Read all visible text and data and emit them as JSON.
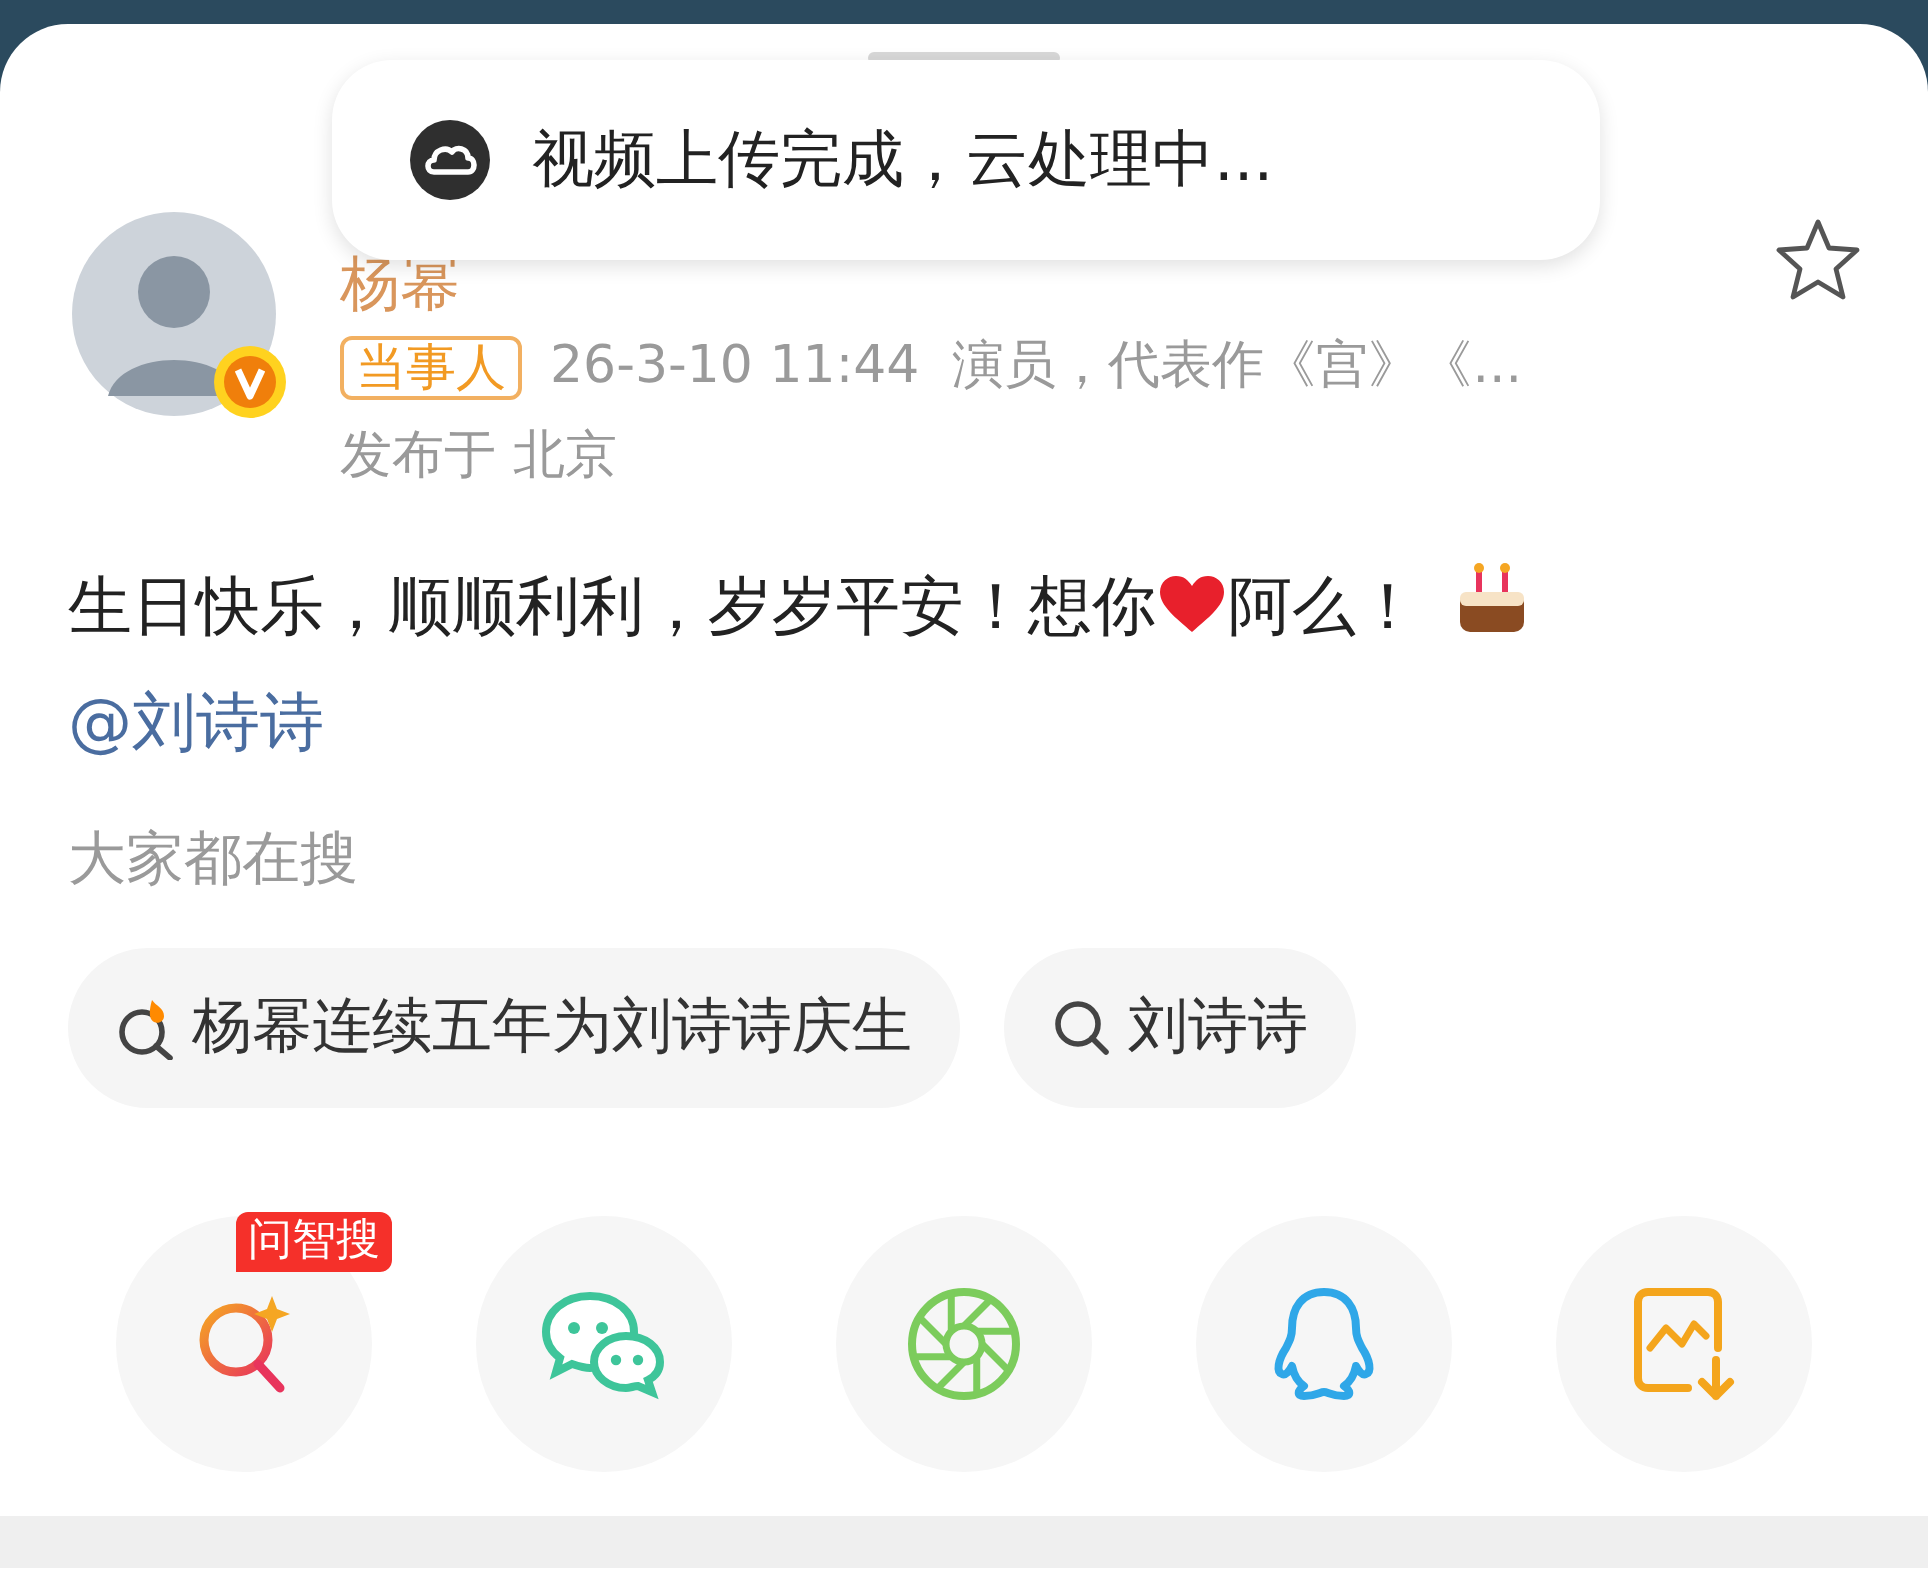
{
  "toast": {
    "text": "视频上传完成，云处理中..."
  },
  "post": {
    "author": "杨幂",
    "tag": "当事人",
    "meta": "26-3-10 11:44  演员，代表作《宫》《...",
    "location": "发布于 北京",
    "favorited": false,
    "body": "生日快乐，顺顺利利，岁岁平安！想你",
    "body_tail": "阿么！",
    "mention": "@刘诗诗"
  },
  "hot_search": {
    "title": "大家都在搜",
    "items": [
      {
        "kind": "hot",
        "label": "杨幂连续五年为刘诗诗庆生"
      },
      {
        "kind": "search",
        "label": "刘诗诗"
      }
    ]
  },
  "share": [
    {
      "kind": "ai-search",
      "badge": "问智搜"
    },
    {
      "kind": "wechat"
    },
    {
      "kind": "moments"
    },
    {
      "kind": "qq"
    },
    {
      "kind": "save-image"
    }
  ]
}
